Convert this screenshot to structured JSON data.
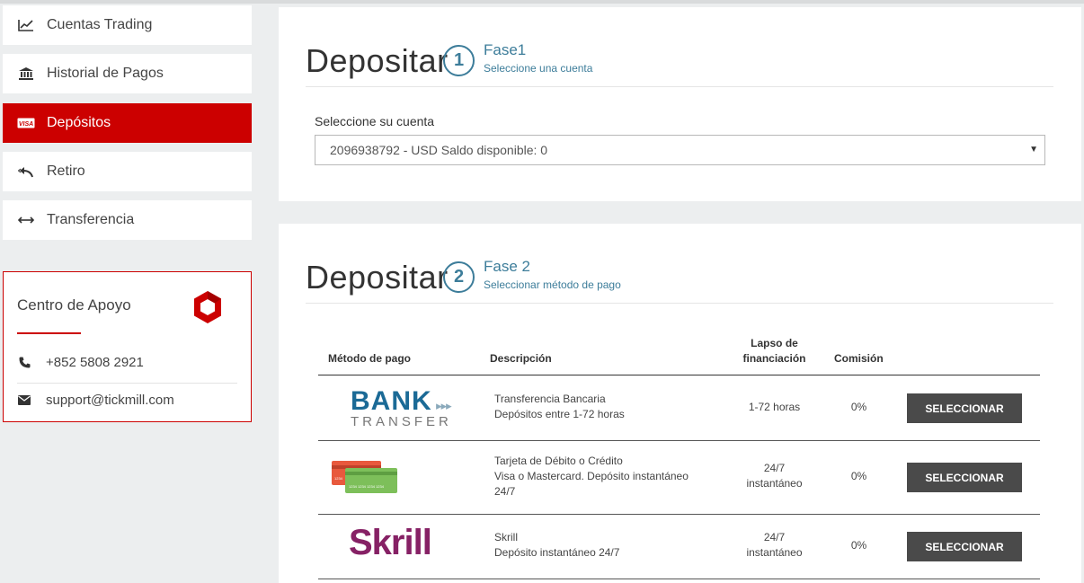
{
  "sidebar": {
    "items": [
      {
        "label": "Cuentas Trading",
        "icon": "chart-line-icon"
      },
      {
        "label": "Historial de Pagos",
        "icon": "bank-icon"
      },
      {
        "label": "Depósitos",
        "icon": "visa-card-icon",
        "active": true
      },
      {
        "label": "Retiro",
        "icon": "reply-arrow-icon"
      },
      {
        "label": "Transferencia",
        "icon": "arrows-horizontal-icon"
      }
    ]
  },
  "support": {
    "title": "Centro de Apoyo",
    "phone": "+852 5808 2921",
    "email": "support@tickmill.com"
  },
  "step1": {
    "title": "Depositar",
    "number": "1",
    "phase": "Fase1",
    "subtitle": "Seleccione una cuenta",
    "account_label": "Seleccione su cuenta",
    "account_value": "2096938792 - USD Saldo disponible: 0"
  },
  "step2": {
    "title": "Depositar",
    "number": "2",
    "phase": "Fase 2",
    "subtitle": "Seleccionar método de pago"
  },
  "table": {
    "headers": {
      "method": "Método de pago",
      "description": "Descripción",
      "period_line1": "Lapso de",
      "period_line2": "financiación",
      "fee": "Comisión"
    },
    "rows": [
      {
        "logo_line1": "BANK",
        "logo_arrows": "▸▸▸",
        "logo_line2": "TRANSFER",
        "desc_line1": "Transferencia Bancaria",
        "desc_line2": "Depósitos entre 1-72 horas",
        "period_line1": "1-72 horas",
        "period_line2": "",
        "fee": "0%",
        "button": "SELECCIONAR"
      },
      {
        "logo": "cards",
        "desc_line1": "Tarjeta de Débito o Crédito",
        "desc_line2": "Visa o Mastercard. Depósito instantáneo 24/7",
        "period_line1": "24/7",
        "period_line2": "instantáneo",
        "fee": "0%",
        "button": "SELECCIONAR"
      },
      {
        "logo_line1": "Skrill",
        "desc_line1": "Skrill",
        "desc_line2": "Depósito instantáneo 24/7",
        "period_line1": "24/7",
        "period_line2": "instantáneo",
        "fee": "0%",
        "button": "SELECCIONAR"
      }
    ]
  },
  "colors": {
    "accent": "#cc0000",
    "step": "#3d7d9a",
    "button": "#4a4a4a"
  }
}
